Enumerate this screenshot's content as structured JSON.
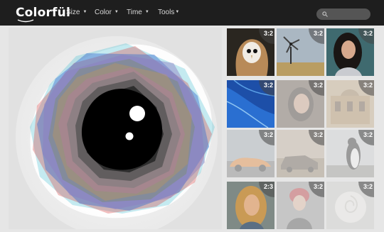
{
  "app": {
    "logo": "Colorfül"
  },
  "nav": [
    {
      "label": "Size"
    },
    {
      "label": "Color"
    },
    {
      "label": "Time"
    },
    {
      "label": "Tools"
    }
  ],
  "search": {
    "placeholder": ""
  },
  "visualization": {
    "center_color": "#000000",
    "palette": [
      "#d94a4a",
      "#3f6fcf",
      "#58c6d6",
      "#8f7cc0",
      "#6b8e3a",
      "#d89a3f",
      "#c76bb4",
      "#9b9b9b"
    ]
  },
  "thumbnails": [
    {
      "subject": "owl",
      "ratio": "3:2",
      "faded": false
    },
    {
      "subject": "windmill",
      "ratio": "3:2",
      "faded": false
    },
    {
      "subject": "woman-portrait",
      "ratio": "3:2",
      "faded": false
    },
    {
      "subject": "blue-feather",
      "ratio": "3:2",
      "faded": false
    },
    {
      "subject": "woman-close-up",
      "ratio": "3:2",
      "faded": true
    },
    {
      "subject": "palace",
      "ratio": "3:2",
      "faded": true
    },
    {
      "subject": "orange-car",
      "ratio": "3:2",
      "faded": true
    },
    {
      "subject": "ruined-car",
      "ratio": "3:2",
      "faded": true
    },
    {
      "subject": "penguin",
      "ratio": "3:2",
      "faded": true
    },
    {
      "subject": "blonde-woman",
      "ratio": "2:3",
      "faded": false
    },
    {
      "subject": "woman-red-hat",
      "ratio": "3:2",
      "faded": true
    },
    {
      "subject": "white-rose",
      "ratio": "3:2",
      "faded": true
    }
  ]
}
